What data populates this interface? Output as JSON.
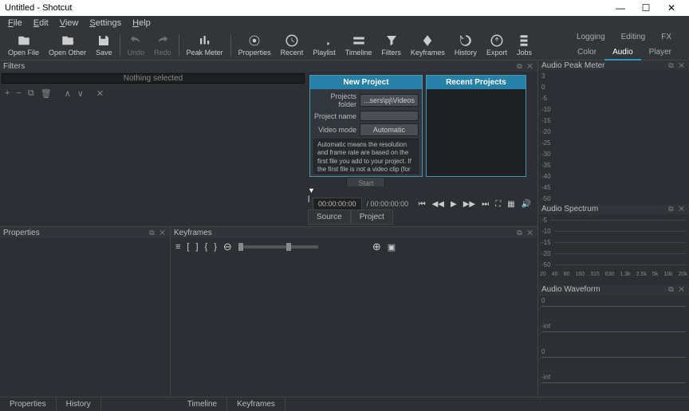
{
  "window": {
    "title": "Untitled - Shotcut"
  },
  "menu": [
    "File",
    "Edit",
    "View",
    "Settings",
    "Help"
  ],
  "toolbar": [
    {
      "label": "Open File"
    },
    {
      "label": "Open Other"
    },
    {
      "label": "Save"
    },
    {
      "label": "Undo",
      "disabled": true
    },
    {
      "label": "Redo",
      "disabled": true
    },
    {
      "label": "Peak Meter"
    },
    {
      "label": "Properties"
    },
    {
      "label": "Recent"
    },
    {
      "label": "Playlist"
    },
    {
      "label": "Timeline"
    },
    {
      "label": "Filters"
    },
    {
      "label": "Keyframes"
    },
    {
      "label": "History"
    },
    {
      "label": "Export"
    },
    {
      "label": "Jobs"
    }
  ],
  "right_tabs": {
    "row1": [
      "Logging",
      "Editing",
      "FX"
    ],
    "row2": [
      "Color",
      "Audio",
      "Player"
    ],
    "active": "Audio"
  },
  "filters": {
    "title": "Filters",
    "empty": "Nothing selected",
    "tools": [
      "+",
      "−",
      "⧉",
      "🗑",
      "∧",
      "∨",
      "✕"
    ]
  },
  "new_project": {
    "title": "New Project",
    "folder_label": "Projects folder",
    "folder_value": "...sers\\pj\\Videos",
    "name_label": "Project name",
    "mode_label": "Video mode",
    "mode_value": "Automatic",
    "desc": "Automatic means the resolution and frame rate are based on the first file you add to your project. If the first file is not a video clip (for example,",
    "start": "Start"
  },
  "recent_projects": {
    "title": "Recent Projects"
  },
  "player": {
    "current": "00:00:00:00",
    "total": "/ 00:00:00:00",
    "tabs": [
      "Source",
      "Project"
    ]
  },
  "panels": {
    "properties": "Properties",
    "keyframes": "Keyframes",
    "peak_meter": "Audio Peak Meter",
    "spectrum": "Audio Spectrum",
    "waveform": "Audio Waveform"
  },
  "bottom_tabs": {
    "left": [
      "Properties",
      "History"
    ],
    "right": [
      "Timeline",
      "Keyframes"
    ]
  },
  "peak_scale": [
    "3",
    "0",
    "-5",
    "-10",
    "-15",
    "-20",
    "-25",
    "-30",
    "-35",
    "-40",
    "-45",
    "-50"
  ],
  "spectrum_scale": [
    "-5",
    "-10",
    "-15",
    "-20",
    "-50"
  ],
  "freq_scale": [
    "20",
    "40",
    "80",
    "160",
    "315",
    "630",
    "1.3k",
    "2.5k",
    "5k",
    "10k",
    "20k"
  ],
  "waveform_levels": [
    "0",
    "-inf",
    "0",
    "-inf"
  ]
}
